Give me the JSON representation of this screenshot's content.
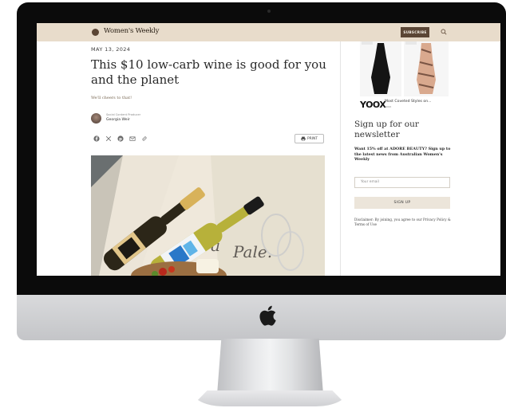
{
  "header": {
    "brand": "Women's Weekly",
    "subscribe_label": "SUBSCRIBE"
  },
  "article": {
    "date": "MAY 13, 2024",
    "headline": "This $10 low-carb wine is good for you and the planet",
    "dek": "We'll cheers to that!",
    "author_role": "Social Content Producer",
    "author_name": "Georgia Weir",
    "print_label": "PRINT",
    "share_icons": [
      "facebook-icon",
      "x-icon",
      "pinterest-icon",
      "email-icon",
      "link-icon"
    ]
  },
  "sidebar": {
    "ad_brand": "YOOX",
    "ad_caption": "Most Coveted Styles on...",
    "ad_sub": "YOOX",
    "newsletter_title": "Sign up for our newsletter",
    "newsletter_offer": "Want 15% off at ADORE BEAUTY? Sign up to the latest news from Australian Women's Weekly",
    "email_placeholder": "Your email",
    "signup_label": "SIGN UP",
    "disclaimer": "Disclaimer: By joining, you agree to our Privacy Policy & Terms of Use"
  },
  "colors": {
    "topbar": "#e8dccb",
    "brand_brown": "#5b4635",
    "signup_bg": "#ece5da"
  }
}
